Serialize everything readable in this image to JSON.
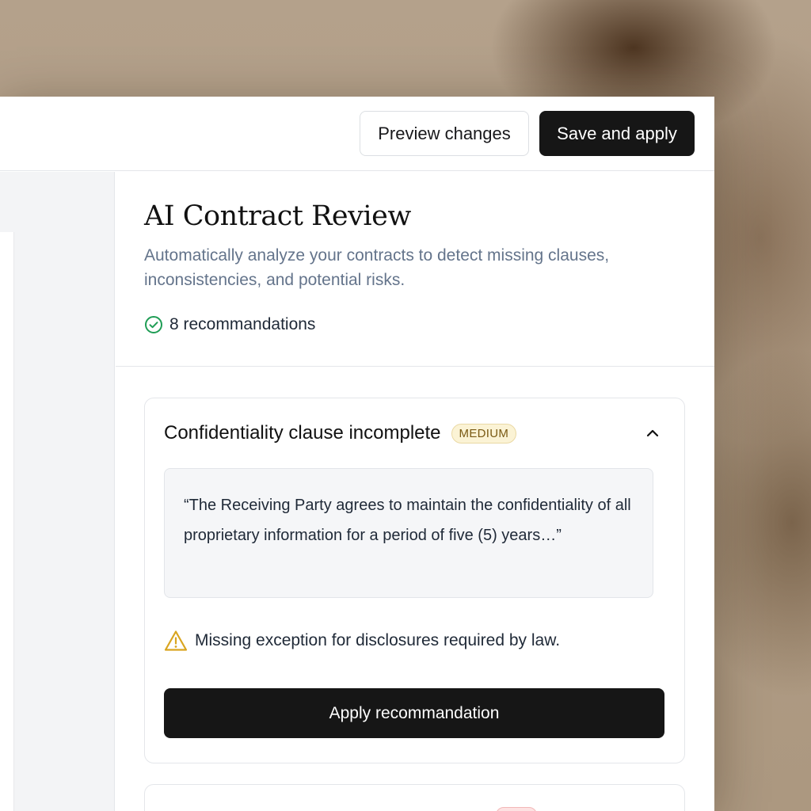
{
  "toolbar": {
    "preview_label": "Preview changes",
    "save_label": "Save and apply"
  },
  "panel": {
    "title": "AI Contract Review",
    "subtitle": "Automatically analyze your contracts to detect missing clauses, inconsistencies, and potential risks.",
    "recommendation_count": "8 recommandations"
  },
  "recommendation": {
    "title": "Confidentiality clause incomplete",
    "severity": "MEDIUM",
    "quote": "“The Receiving Party agrees to maintain the confidentiality of all proprietary information for a period of five (5) years…”",
    "warning": "Missing exception for disclosures required by law.",
    "apply_label": "Apply recommandation"
  },
  "icons": {
    "count": "check-circle-icon",
    "collapse": "chevron-up-icon",
    "warning": "warning-triangle-icon"
  },
  "colors": {
    "primary_button": "#161616",
    "success": "#1f9d55",
    "warning": "#d9a520",
    "medium_badge_bg": "#fbf3d5",
    "high_badge_bg": "#fde2e2",
    "muted_text": "#64748b"
  }
}
